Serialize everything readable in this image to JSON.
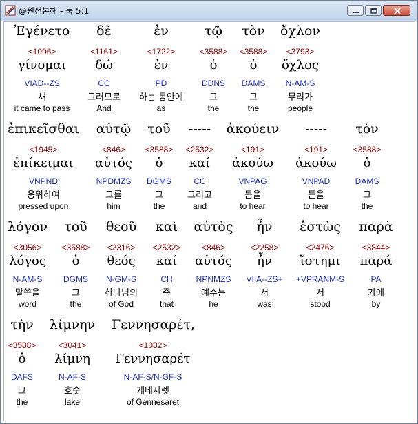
{
  "window": {
    "title": "@원전본해 - 눅 5:1"
  },
  "rows": [
    {
      "words": [
        {
          "greek": "Ἐγένετο",
          "strong": "<1096>",
          "lemma": "γίνομαι",
          "parse": "VIAD--ZS",
          "kor": "새",
          "eng": "it came to pass"
        },
        {
          "greek": "δὲ",
          "strong": "<1161>",
          "lemma": "δώ",
          "parse": "CC",
          "kor": "그러므로",
          "eng": "And"
        },
        {
          "greek": "ἐν",
          "strong": "<1722>",
          "lemma": "ἐν",
          "parse": "PD",
          "kor": "하는 동안에",
          "eng": "as"
        },
        {
          "greek": "τῷ",
          "strong": "<3588>",
          "lemma": "ὁ",
          "parse": "DDNS",
          "kor": "그",
          "eng": "the"
        },
        {
          "greek": "τὸν",
          "strong": "<3588>",
          "lemma": "ὁ",
          "parse": "DAMS",
          "kor": "그",
          "eng": "the"
        },
        {
          "greek": "ὄχλον",
          "strong": "<3793>",
          "lemma": "ὄχλος",
          "parse": "N-AM-S",
          "kor": "무리가",
          "eng": "people"
        }
      ]
    },
    {
      "words": [
        {
          "greek": "ἐπικεῖσθαι",
          "strong": "<1945>",
          "lemma": "ἐπίκειμαι",
          "parse": "VNPND",
          "kor": "옹위하여",
          "eng": "pressed upon"
        },
        {
          "greek": "αὐτῷ",
          "strong": "<846>",
          "lemma": "αὐτός",
          "parse": "NPDMZS",
          "kor": "그를",
          "eng": "him"
        },
        {
          "greek": "τοῦ",
          "strong": "<3588>",
          "lemma": "ὁ",
          "parse": "DGMS",
          "kor": "그",
          "eng": "the"
        },
        {
          "greek": "-----",
          "strong": "<2532>",
          "lemma": "καί",
          "parse": "CC",
          "kor": "그리고",
          "eng": "and"
        },
        {
          "greek": "ἀκούειν",
          "strong": "<191>",
          "lemma": "ἀκούω",
          "parse": "VNPAG",
          "kor": "듣을",
          "eng": "to hear"
        },
        {
          "greek": "-----",
          "strong": "<191>",
          "lemma": "ἀκούω",
          "parse": "VNPAD",
          "kor": "듣을",
          "eng": "to hear"
        },
        {
          "greek": "τὸν",
          "strong": "<3588>",
          "lemma": "ὁ",
          "parse": "DAMS",
          "kor": "그",
          "eng": "the"
        }
      ]
    },
    {
      "words": [
        {
          "greek": "λόγον",
          "strong": "<3056>",
          "lemma": "λόγος",
          "parse": "N-AM-S",
          "kor": "말씀을",
          "eng": "word"
        },
        {
          "greek": "τοῦ",
          "strong": "<3588>",
          "lemma": "ὁ",
          "parse": "DGMS",
          "kor": "그",
          "eng": "the"
        },
        {
          "greek": "θεοῦ",
          "strong": "<2316>",
          "lemma": "θεός",
          "parse": "N-GM-S",
          "kor": "하나님의",
          "eng": "of God"
        },
        {
          "greek": "καὶ",
          "strong": "<2532>",
          "lemma": "καί",
          "parse": "CH",
          "kor": "즉",
          "eng": "that"
        },
        {
          "greek": "αὐτὸς",
          "strong": "<846>",
          "lemma": "αὐτός",
          "parse": "NPNMZS",
          "kor": "예수는",
          "eng": "he"
        },
        {
          "greek": "ἦν",
          "strong": "<2258>",
          "lemma": "ἦν",
          "parse": "VIIA--ZS+",
          "kor": "서",
          "eng": "was"
        },
        {
          "greek": "ἑστὼς",
          "strong": "<2476>",
          "lemma": "ἵστημι",
          "parse": "+VPRANM-S",
          "kor": "서",
          "eng": "stood"
        },
        {
          "greek": "παρὰ",
          "strong": "<3844>",
          "lemma": "παρά",
          "parse": "PA",
          "kor": "가에",
          "eng": "by"
        }
      ]
    },
    {
      "words": [
        {
          "greek": "τὴν",
          "strong": "<3588>",
          "lemma": "ὁ",
          "parse": "DAFS",
          "kor": "그",
          "eng": "the"
        },
        {
          "greek": "λίμνην",
          "strong": "<3041>",
          "lemma": "λίμνη",
          "parse": "N-AF-S",
          "kor": "호숫",
          "eng": "lake"
        },
        {
          "greek": "Γεννησαρέτ,",
          "strong": "<1082>",
          "lemma": "Γεννησαρέτ",
          "parse": "N-AF-S/N-GF-S",
          "kor": "게네사렛",
          "eng": "of Gennesaret"
        }
      ]
    }
  ]
}
